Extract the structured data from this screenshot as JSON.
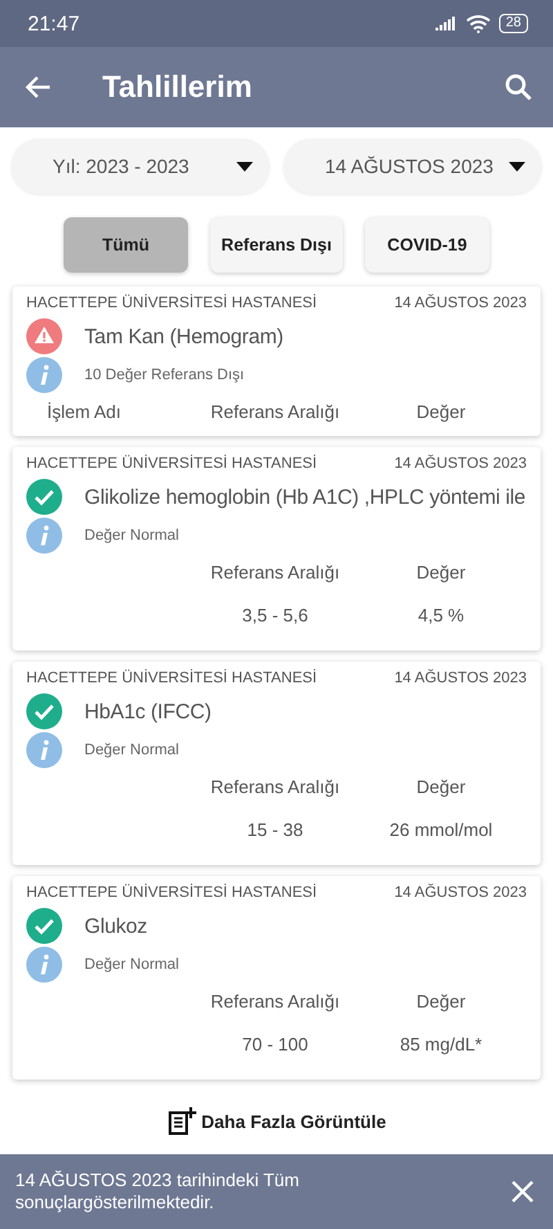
{
  "status_bar": {
    "time": "21:47",
    "battery": "28"
  },
  "app_bar": {
    "title": "Tahlillerim"
  },
  "filters": [
    {
      "label": "Yıl: 2023 - 2023"
    },
    {
      "label": "14 AĞUSTOS 2023"
    }
  ],
  "chips": [
    {
      "label": "Tümü",
      "selected": true
    },
    {
      "label": "Referans Dışı",
      "selected": false
    },
    {
      "label": "COVID-19",
      "selected": false
    }
  ],
  "results": [
    {
      "hospital": "HACETTEPE ÜNİVERSİTESİ HASTANESİ",
      "date": "14 AĞUSTOS 2023",
      "kind": "warning",
      "name": "Tam Kan (Hemogram)",
      "note": "10 Değer Referans Dışı",
      "headers": {
        "process": "İşlem Adı",
        "range": "Referans Aralığı",
        "value": "Değer"
      }
    },
    {
      "hospital": "HACETTEPE ÜNİVERSİTESİ HASTANESİ",
      "date": "14 AĞUSTOS 2023",
      "kind": "normal",
      "name": "Glikolize hemoglobin (Hb A1C)  ,HPLC yöntemi ile",
      "note": "Değer Normal",
      "headers": {
        "range": "Referans Aralığı",
        "value": "Değer"
      },
      "values": {
        "range": "3,5 - 5,6",
        "value": "4,5 %"
      }
    },
    {
      "hospital": "HACETTEPE ÜNİVERSİTESİ HASTANESİ",
      "date": "14 AĞUSTOS 2023",
      "kind": "normal",
      "name": "HbA1c (IFCC)",
      "note": "Değer Normal",
      "headers": {
        "range": "Referans Aralığı",
        "value": "Değer"
      },
      "values": {
        "range": "15 - 38",
        "value": "26 mmol/mol"
      }
    },
    {
      "hospital": "HACETTEPE ÜNİVERSİTESİ HASTANESİ",
      "date": "14 AĞUSTOS 2023",
      "kind": "normal",
      "name": "Glukoz",
      "note": "Değer Normal",
      "headers": {
        "range": "Referans Aralığı",
        "value": "Değer"
      },
      "values": {
        "range": "70 - 100",
        "value": "85 mg/dL*"
      }
    }
  ],
  "more_button": {
    "label": "Daha Fazla Görüntüle"
  },
  "snackbar": {
    "message": "14 AĞUSTOS 2023 tarihindeki Tüm sonuçlargösterilmektedir."
  }
}
